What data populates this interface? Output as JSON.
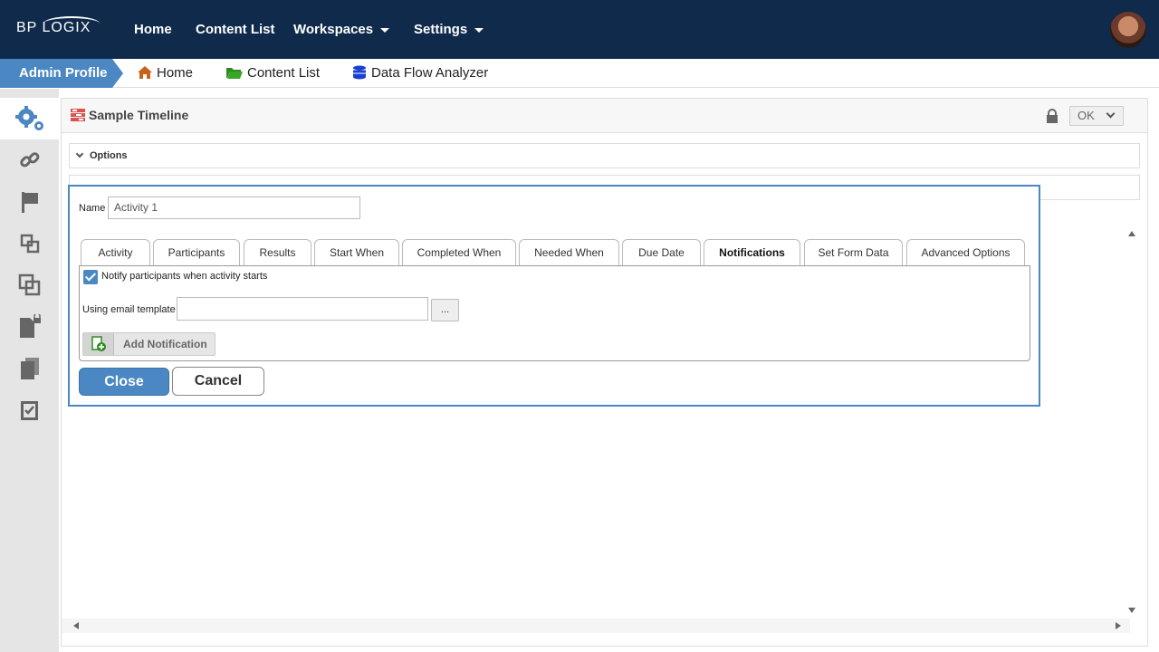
{
  "topbar": {
    "logo": "BP LOGIX",
    "nav": [
      {
        "label": "Home",
        "has_menu": false
      },
      {
        "label": "Content List",
        "has_menu": false
      },
      {
        "label": "Workspaces",
        "has_menu": true
      },
      {
        "label": "Settings",
        "has_menu": true
      }
    ],
    "avatar_icon": "user-avatar"
  },
  "breadcrumb": {
    "active": "Admin Profile",
    "items": [
      {
        "label": "Home",
        "icon": "house-icon",
        "color": "#c8621a"
      },
      {
        "label": "Content List",
        "icon": "folder-icon",
        "color": "#2e8b1f"
      },
      {
        "label": "Data Flow Analyzer",
        "icon": "database-icon",
        "color": "#1b3fd1"
      }
    ]
  },
  "sidebar": {
    "items": [
      {
        "icon": "gears-icon",
        "active": true
      },
      {
        "icon": "link-icon",
        "active": false
      },
      {
        "icon": "flag-icon",
        "active": false
      },
      {
        "icon": "copy-small-icon",
        "active": false
      },
      {
        "icon": "copy-large-icon",
        "active": false
      },
      {
        "icon": "locked-document-icon",
        "active": false
      },
      {
        "icon": "documents-icon",
        "active": false
      },
      {
        "icon": "checklist-icon",
        "active": false
      }
    ]
  },
  "panel": {
    "title": "Sample Timeline",
    "ok_label": "OK",
    "options_label": "Options"
  },
  "dialog": {
    "name_label": "Name",
    "name_value": "Activity 1",
    "tabs": [
      {
        "label": "Activity",
        "active": false
      },
      {
        "label": "Participants",
        "active": false
      },
      {
        "label": "Results",
        "active": false
      },
      {
        "label": "Start When",
        "active": false
      },
      {
        "label": "Completed When",
        "active": false
      },
      {
        "label": "Needed When",
        "active": false
      },
      {
        "label": "Due Date",
        "active": false
      },
      {
        "label": "Notifications",
        "active": true
      },
      {
        "label": "Set Form Data",
        "active": false
      },
      {
        "label": "Advanced Options",
        "active": false
      }
    ],
    "notify_label": "Notify participants when activity starts",
    "notify_checked": true,
    "template_label": "Using email template",
    "template_value": "",
    "browse_label": "...",
    "add_notification_label": "Add Notification",
    "close_label": "Close",
    "cancel_label": "Cancel"
  },
  "colors": {
    "topbar": "#0f2a4b",
    "accent": "#4b88c3",
    "sidebar": "#e5e5e5"
  }
}
